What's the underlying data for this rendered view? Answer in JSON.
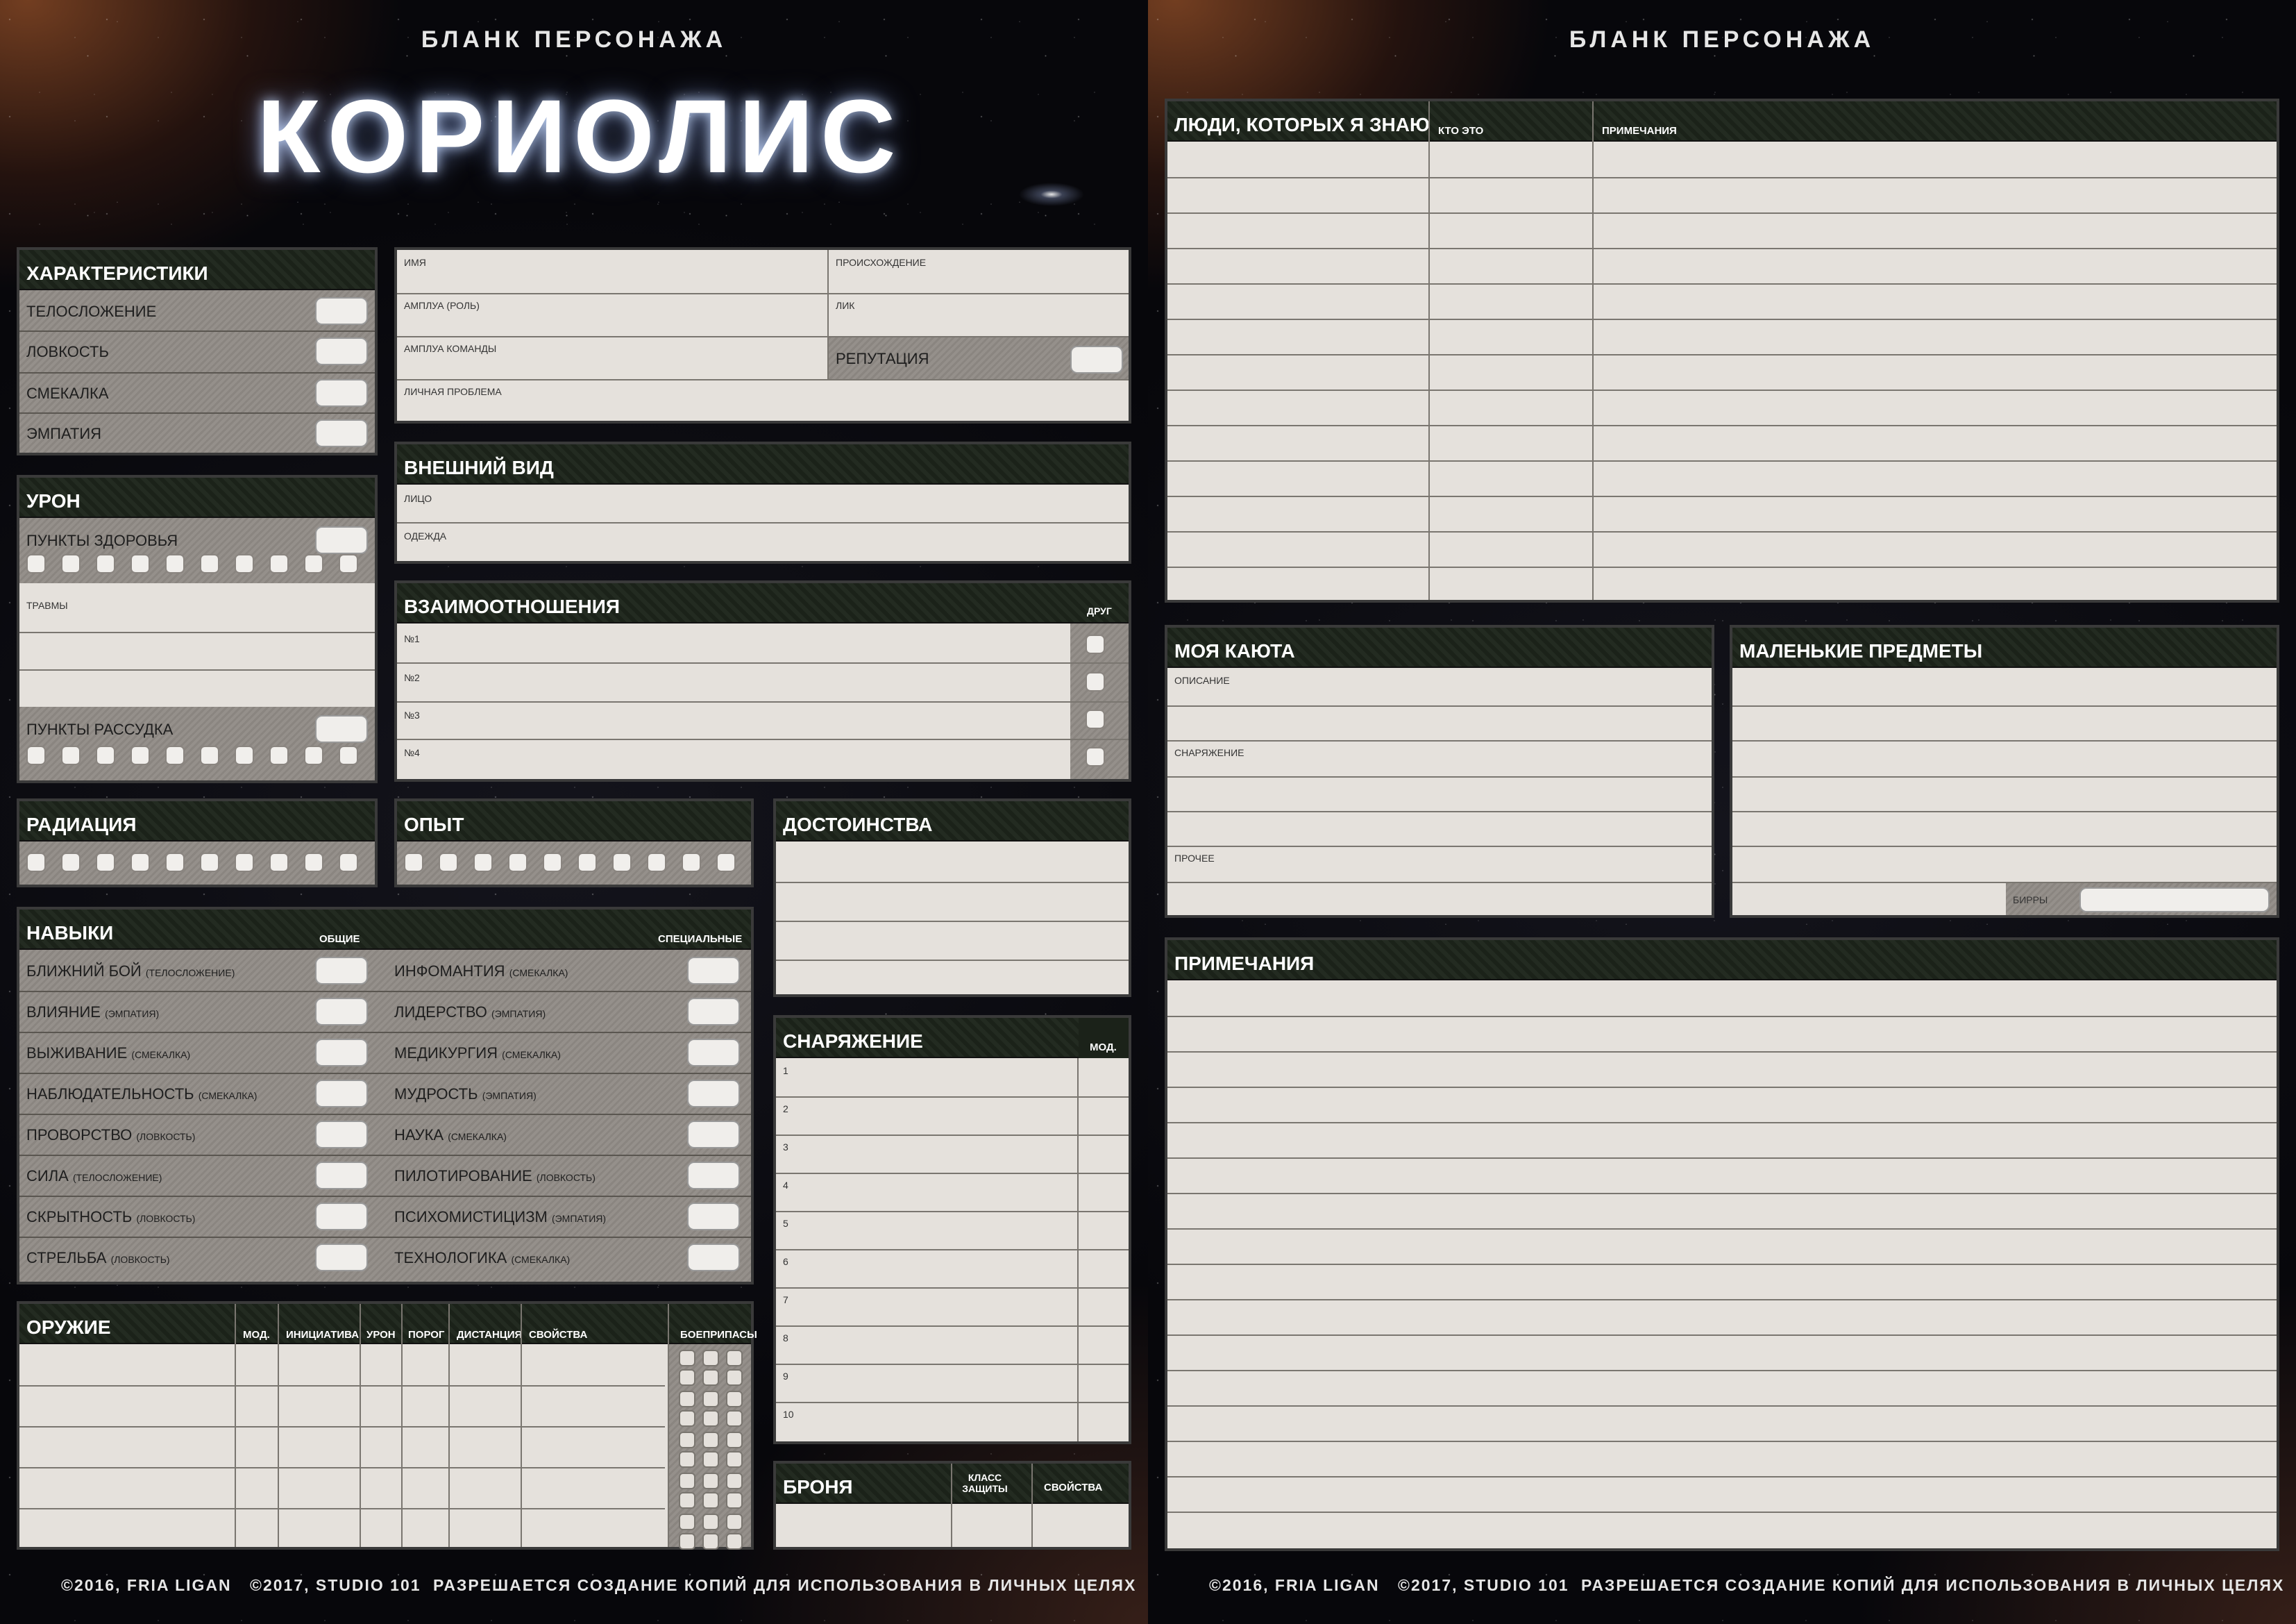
{
  "header": "БЛАНК ПЕРСОНАЖА",
  "logo": "КОРИОЛИС",
  "footer": {
    "c1": "©2016, FRIA LIGAN",
    "c2": "©2017, STUDIO 101",
    "c3": "РАЗРЕШАЕТСЯ СОЗДАНИЕ КОПИЙ ДЛЯ ИСПОЛЬЗОВАНИЯ В ЛИЧНЫХ ЦЕЛЯХ"
  },
  "attributes": {
    "title": "ХАРАКТЕРИСТИКИ",
    "items": [
      "ТЕЛОСЛОЖЕНИЕ",
      "ЛОВКОСТЬ",
      "СМЕКАЛКА",
      "ЭМПАТИЯ"
    ]
  },
  "identity": {
    "name": "ИМЯ",
    "origin": "ПРОИСХОЖДЕНИЕ",
    "role": "АМПЛУА (РОЛЬ)",
    "face": "ЛИК",
    "team_role": "АМПЛУА КОМАНДЫ",
    "reputation": "РЕПУТАЦИЯ",
    "problem": "ЛИЧНАЯ ПРОБЛЕМА"
  },
  "damage": {
    "title": "УРОН",
    "hp": "ПУНКТЫ ЗДОРОВЬЯ",
    "injuries": "ТРАВМЫ",
    "mp": "ПУНКТЫ РАССУДКА"
  },
  "appearance": {
    "title": "ВНЕШНИЙ ВИД",
    "face": "ЛИЦО",
    "clothes": "ОДЕЖДА"
  },
  "relations": {
    "title": "ВЗАИМООТНОШЕНИЯ",
    "buddy": "ДРУГ",
    "rows": [
      "№1",
      "№2",
      "№3",
      "№4"
    ]
  },
  "radiation": {
    "title": "РАДИАЦИЯ"
  },
  "experience": {
    "title": "ОПЫТ"
  },
  "talents": {
    "title": "ДОСТОИНСТВА"
  },
  "skills": {
    "title": "НАВЫКИ",
    "general": "ОБЩИЕ",
    "advanced": "СПЕЦИАЛЬНЫЕ",
    "left": [
      {
        "name": "БЛИЖНИЙ БОЙ",
        "attr": "(ТЕЛОСЛОЖЕНИЕ)"
      },
      {
        "name": "ВЛИЯНИЕ",
        "attr": "(ЭМПАТИЯ)"
      },
      {
        "name": "ВЫЖИВАНИЕ",
        "attr": "(СМЕКАЛКА)"
      },
      {
        "name": "НАБЛЮДАТЕЛЬНОСТЬ",
        "attr": "(СМЕКАЛКА)"
      },
      {
        "name": "ПРОВОРСТВО",
        "attr": "(ЛОВКОСТЬ)"
      },
      {
        "name": "СИЛА",
        "attr": "(ТЕЛОСЛОЖЕНИЕ)"
      },
      {
        "name": "СКРЫТНОСТЬ",
        "attr": "(ЛОВКОСТЬ)"
      },
      {
        "name": "СТРЕЛЬБА",
        "attr": "(ЛОВКОСТЬ)"
      }
    ],
    "right": [
      {
        "name": "ИНФОМАНТИЯ",
        "attr": "(СМЕКАЛКА)"
      },
      {
        "name": "ЛИДЕРСТВО",
        "attr": "(ЭМПАТИЯ)"
      },
      {
        "name": "МЕДИКУРГИЯ",
        "attr": "(СМЕКАЛКА)"
      },
      {
        "name": "МУДРОСТЬ",
        "attr": "(ЭМПАТИЯ)"
      },
      {
        "name": "НАУКА",
        "attr": "(СМЕКАЛКА)"
      },
      {
        "name": "ПИЛОТИРОВАНИЕ",
        "attr": "(ЛОВКОСТЬ)"
      },
      {
        "name": "ПСИХОМИСТИЦИЗМ",
        "attr": "(ЭМПАТИЯ)"
      },
      {
        "name": "ТЕХНОЛОГИКА",
        "attr": "(СМЕКАЛКА)"
      }
    ]
  },
  "gear": {
    "title": "СНАРЯЖЕНИЕ",
    "bonus": "МОД.",
    "rows": [
      "1",
      "2",
      "3",
      "4",
      "5",
      "6",
      "7",
      "8",
      "9",
      "10"
    ]
  },
  "weapons": {
    "title": "ОРУЖИЕ",
    "cols": [
      "МОД.",
      "ИНИЦИАТИВА",
      "УРОН",
      "ПОРОГ",
      "ДИСТАНЦИЯ",
      "СВОЙСТВА",
      "БОЕПРИПАСЫ"
    ]
  },
  "armor": {
    "title": "БРОНЯ",
    "rating": "КЛАСС ЗАЩИТЫ",
    "features": "СВОЙСТВА"
  },
  "people": {
    "title": "ЛЮДИ, КОТОРЫХ Я ЗНАЮ",
    "who": "КТО ЭТО",
    "notes": "ПРИМЕЧАНИЯ"
  },
  "cabin": {
    "title": "МОЯ КАЮТА",
    "desc": "ОПИСАНИЕ",
    "gear": "СНАРЯЖЕНИЕ",
    "other": "ПРОЧЕЕ"
  },
  "tiny": {
    "title": "МАЛЕНЬКИЕ ПРЕДМЕТЫ",
    "birr": "БИРРЫ"
  },
  "notes": {
    "title": "ПРИМЕЧАНИЯ"
  }
}
